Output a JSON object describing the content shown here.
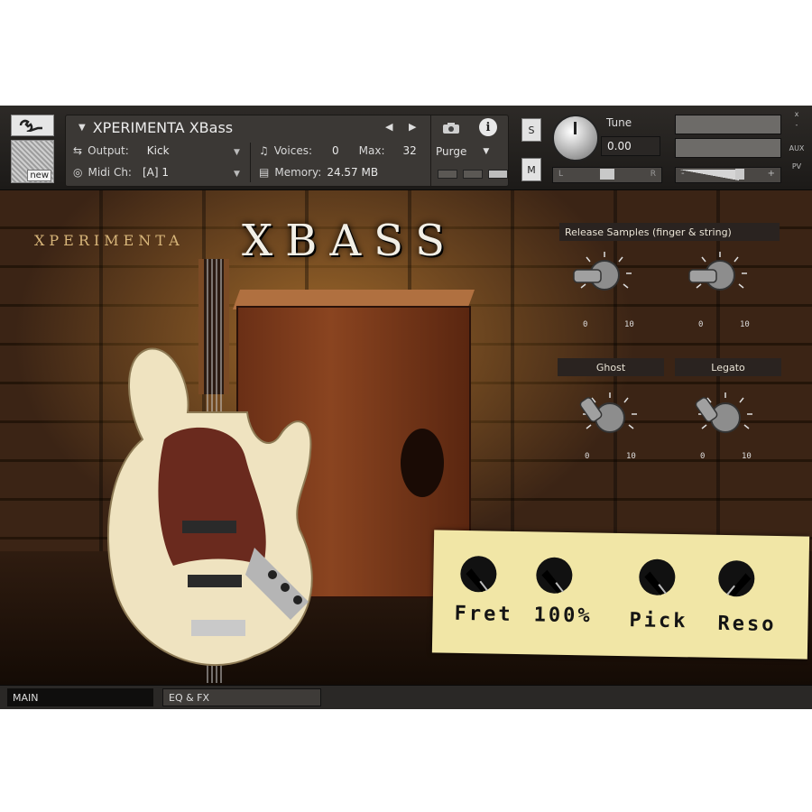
{
  "header": {
    "instrument_name": "XPERIMENTA XBass",
    "new_label": "new",
    "output_label": "Output:",
    "output_value": "Kick",
    "voices_label": "Voices:",
    "voices_value": "0",
    "max_label": "Max:",
    "max_value": "32",
    "midi_label": "Midi Ch:",
    "midi_value": "[A] 1",
    "memory_label": "Memory:",
    "memory_value": "24.57 MB",
    "purge_label": "Purge",
    "solo_label": "S",
    "mute_label": "M",
    "tune_label": "Tune",
    "tune_value": "0.00",
    "pan_left": "L",
    "pan_right": "R",
    "vol_minus": "-",
    "vol_plus": "+",
    "close_glyph": "x",
    "minimize_glyph": "-",
    "aux_label": "AUX",
    "pv_label": "PV"
  },
  "main": {
    "brand": "XPERIMENTA",
    "title": "XBASS",
    "release_label": "Release Samples (finger & string)",
    "ghost_label": "Ghost",
    "legato_label": "Legato",
    "knob_min": "0",
    "knob_max": "10",
    "note_labels": [
      "Fret",
      "100%",
      "Pick",
      "Reso"
    ]
  },
  "tabs": {
    "main": "MAIN",
    "eqfx": "EQ & FX"
  },
  "colors": {
    "header_bg": "#2d2a27",
    "note_paper": "#f1e6a6",
    "wood": "#3b2415"
  }
}
